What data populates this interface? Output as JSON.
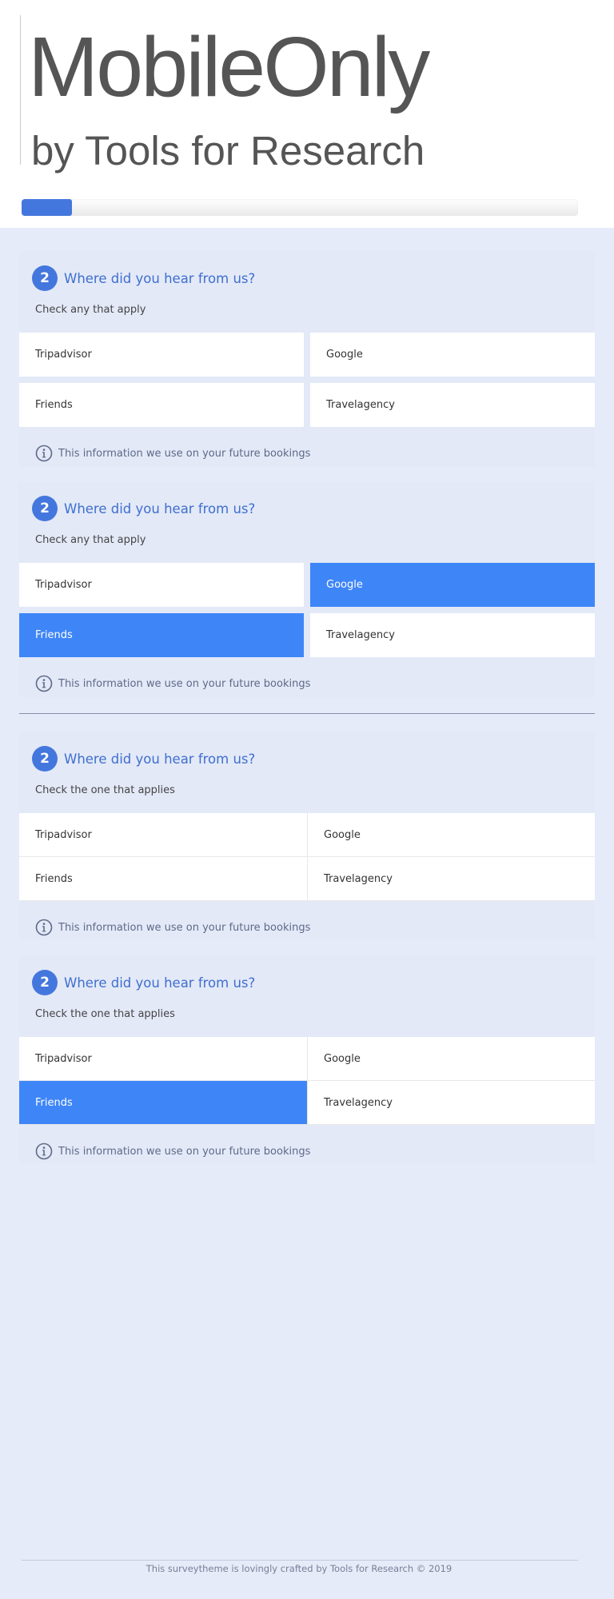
{
  "header": {
    "title": "MobileOnly",
    "subtitle": "by Tools for Research",
    "progress_fraction": 0.09
  },
  "questions": [
    {
      "number": "2",
      "title": "Where did you hear from us?",
      "help": "Check any that apply",
      "type": "checkbox",
      "options": [
        {
          "label": "Tripadvisor",
          "selected": false
        },
        {
          "label": "Google",
          "selected": false
        },
        {
          "label": "Friends",
          "selected": false
        },
        {
          "label": "Travelagency",
          "selected": false
        }
      ],
      "info": "This information we use on your future bookings"
    },
    {
      "number": "2",
      "title": "Where did you hear from us?",
      "help": "Check any that apply",
      "type": "checkbox",
      "options": [
        {
          "label": "Tripadvisor",
          "selected": false
        },
        {
          "label": "Google",
          "selected": true
        },
        {
          "label": "Friends",
          "selected": true
        },
        {
          "label": "Travelagency",
          "selected": false
        }
      ],
      "info": "This information we use on your future bookings"
    },
    {
      "number": "2",
      "title": "Where did you hear from us?",
      "help": "Check the one that applies",
      "type": "radio",
      "options": [
        {
          "label": "Tripadvisor",
          "selected": false
        },
        {
          "label": "Google",
          "selected": false
        },
        {
          "label": "Friends",
          "selected": false
        },
        {
          "label": "Travelagency",
          "selected": false
        }
      ],
      "info": "This information we use on your future bookings"
    },
    {
      "number": "2",
      "title": "Where did you hear from us?",
      "help": "Check the one that applies",
      "type": "radio",
      "options": [
        {
          "label": "Tripadvisor",
          "selected": false
        },
        {
          "label": "Google",
          "selected": false
        },
        {
          "label": "Friends",
          "selected": true
        },
        {
          "label": "Travelagency",
          "selected": false
        }
      ],
      "info": "This information we use on your future bookings"
    }
  ],
  "footer": {
    "text": "This surveytheme is lovingly crafted by Tools for Research © 2019"
  },
  "colors": {
    "accent": "#4477dd",
    "selected": "#3e85f8",
    "background": "#e6ebf9",
    "question_title": "#3f6fcf"
  },
  "icons": {
    "info": "info-circle-icon"
  }
}
